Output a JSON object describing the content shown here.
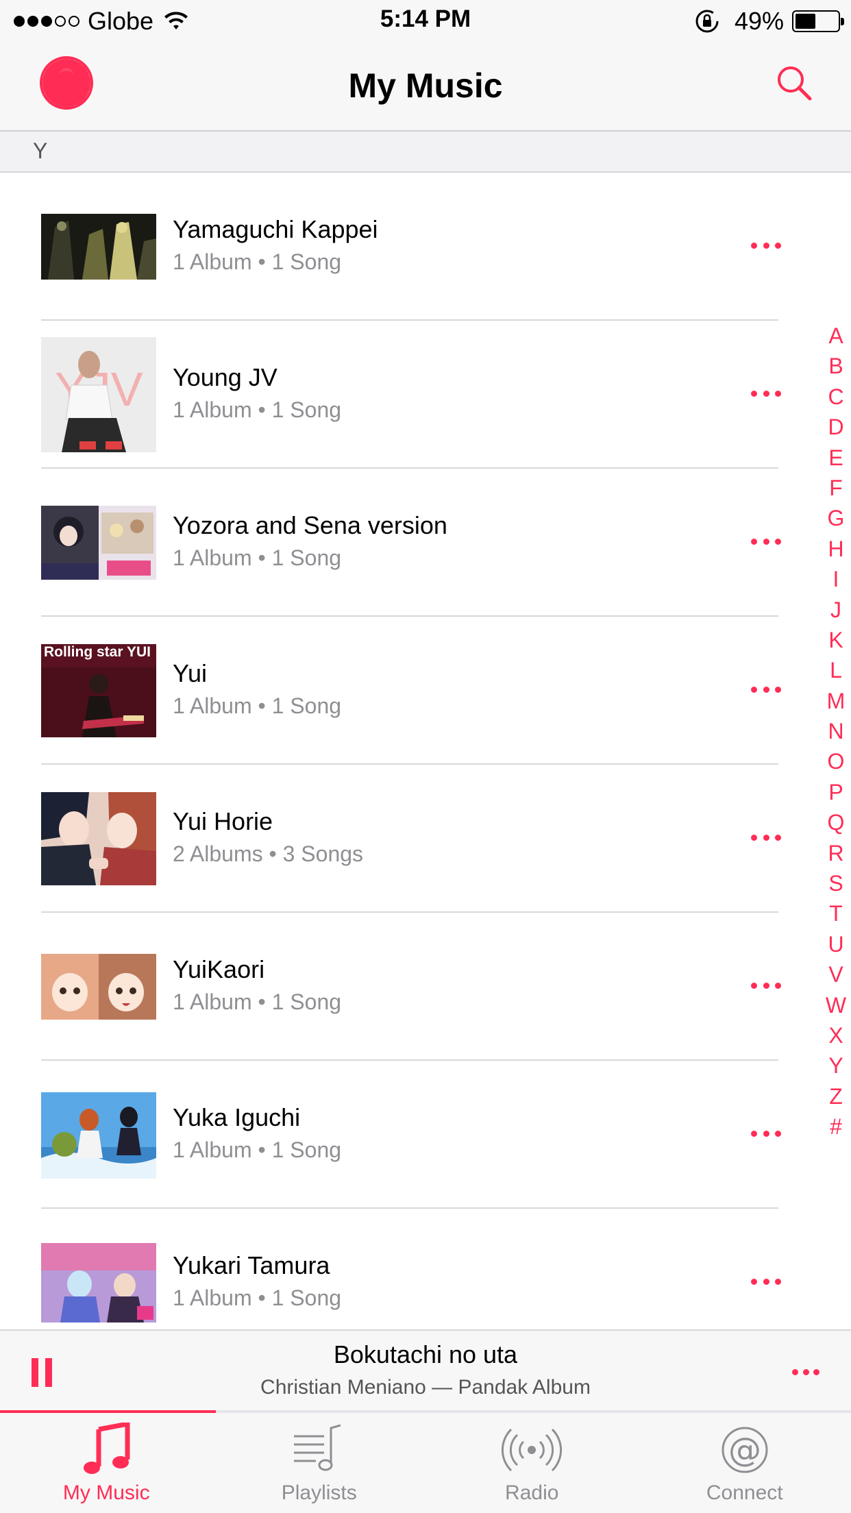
{
  "status_bar": {
    "carrier": "Globe",
    "time": "5:14 PM",
    "battery_percent": "49%",
    "signal_bars_filled": 3,
    "signal_bars_total": 5,
    "battery_level": 0.49
  },
  "nav": {
    "title": "My Music",
    "avatar_icon": "person-icon",
    "search_icon": "search-icon"
  },
  "section": {
    "letter": "Y"
  },
  "artists": [
    {
      "name": "Yamaguchi Kappei",
      "subtitle": "1 Album • 1 Song"
    },
    {
      "name": "Young JV",
      "subtitle": "1 Album • 1 Song"
    },
    {
      "name": "Yozora and Sena version",
      "subtitle": "1 Album • 1 Song"
    },
    {
      "name": "Yui",
      "subtitle": "1 Album • 1 Song",
      "art_text": "Rolling star YUI"
    },
    {
      "name": "Yui Horie",
      "subtitle": "2 Albums • 3 Songs"
    },
    {
      "name": "YuiKaori",
      "subtitle": "1 Album • 1 Song"
    },
    {
      "name": "Yuka Iguchi",
      "subtitle": "1 Album • 1 Song"
    },
    {
      "name": "Yukari Tamura",
      "subtitle": "1 Album • 1 Song"
    }
  ],
  "index_letters": [
    "A",
    "B",
    "C",
    "D",
    "E",
    "F",
    "G",
    "H",
    "I",
    "J",
    "K",
    "L",
    "M",
    "N",
    "O",
    "P",
    "Q",
    "R",
    "S",
    "T",
    "U",
    "V",
    "W",
    "X",
    "Y",
    "Z",
    "#"
  ],
  "now_playing": {
    "title": "Bokutachi no uta",
    "subtitle": "Christian Meniano  — Pandak Album",
    "progress": 0.254
  },
  "tabs": [
    {
      "label": "My Music",
      "icon": "music-note-icon",
      "active": true
    },
    {
      "label": "Playlists",
      "icon": "playlist-icon",
      "active": false
    },
    {
      "label": "Radio",
      "icon": "radio-icon",
      "active": false
    },
    {
      "label": "Connect",
      "icon": "at-sign-icon",
      "active": false
    }
  ],
  "colors": {
    "accent": "#ff2d55",
    "secondary_text": "#8e8e93",
    "bar_background": "#f7f7f7"
  }
}
